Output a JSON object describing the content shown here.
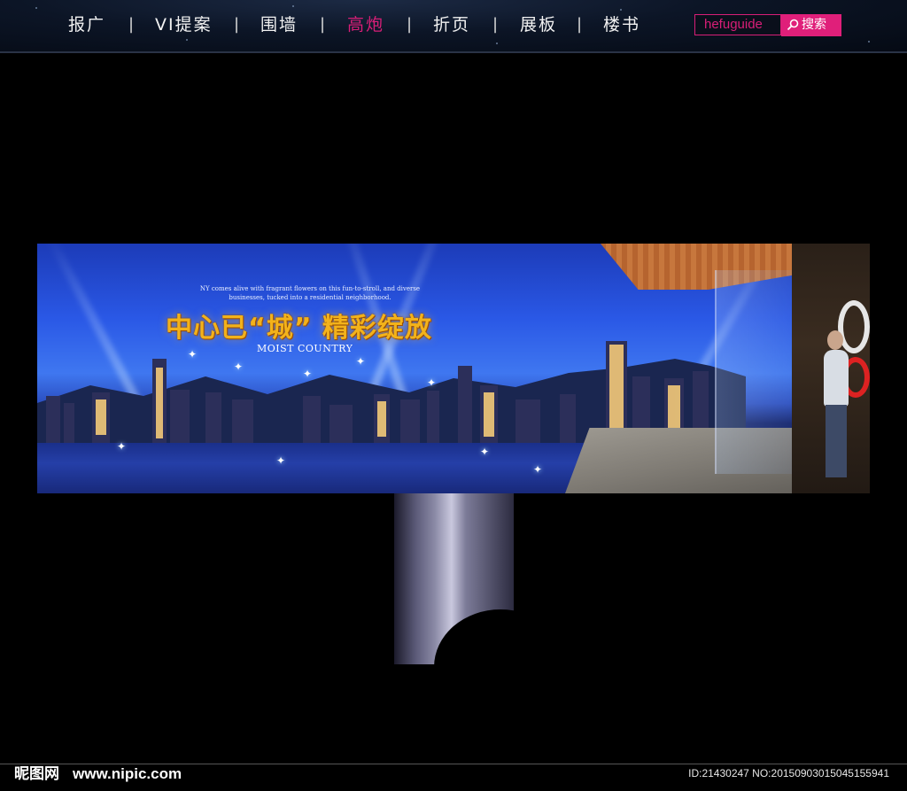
{
  "nav": {
    "items": [
      {
        "label": "报广",
        "active": false
      },
      {
        "label": "VI提案",
        "active": false
      },
      {
        "label": "围墙",
        "active": false
      },
      {
        "label": "高炮",
        "active": true
      },
      {
        "label": "折页",
        "active": false
      },
      {
        "label": "展板",
        "active": false
      },
      {
        "label": "楼书",
        "active": false
      }
    ],
    "separator": "|"
  },
  "search": {
    "value": "hefuguide",
    "button_label": "搜索"
  },
  "billboard": {
    "headline": "中心已“城” 精彩绽放",
    "subheadline": "MOIST COUNTRY",
    "tagline": "NY comes alive with fragrant flowers on this fun-to-stroll, and diverse businesses, tucked into a residential neighborhood."
  },
  "footer": {
    "logo": "昵图网",
    "site": "www.nipic.com",
    "id_text": "ID:21430247 NO:20150903015045155941"
  },
  "colors": {
    "accent": "#d81e77",
    "nav_bg": "#0c1526",
    "headline_gold": "#f3b21a"
  }
}
